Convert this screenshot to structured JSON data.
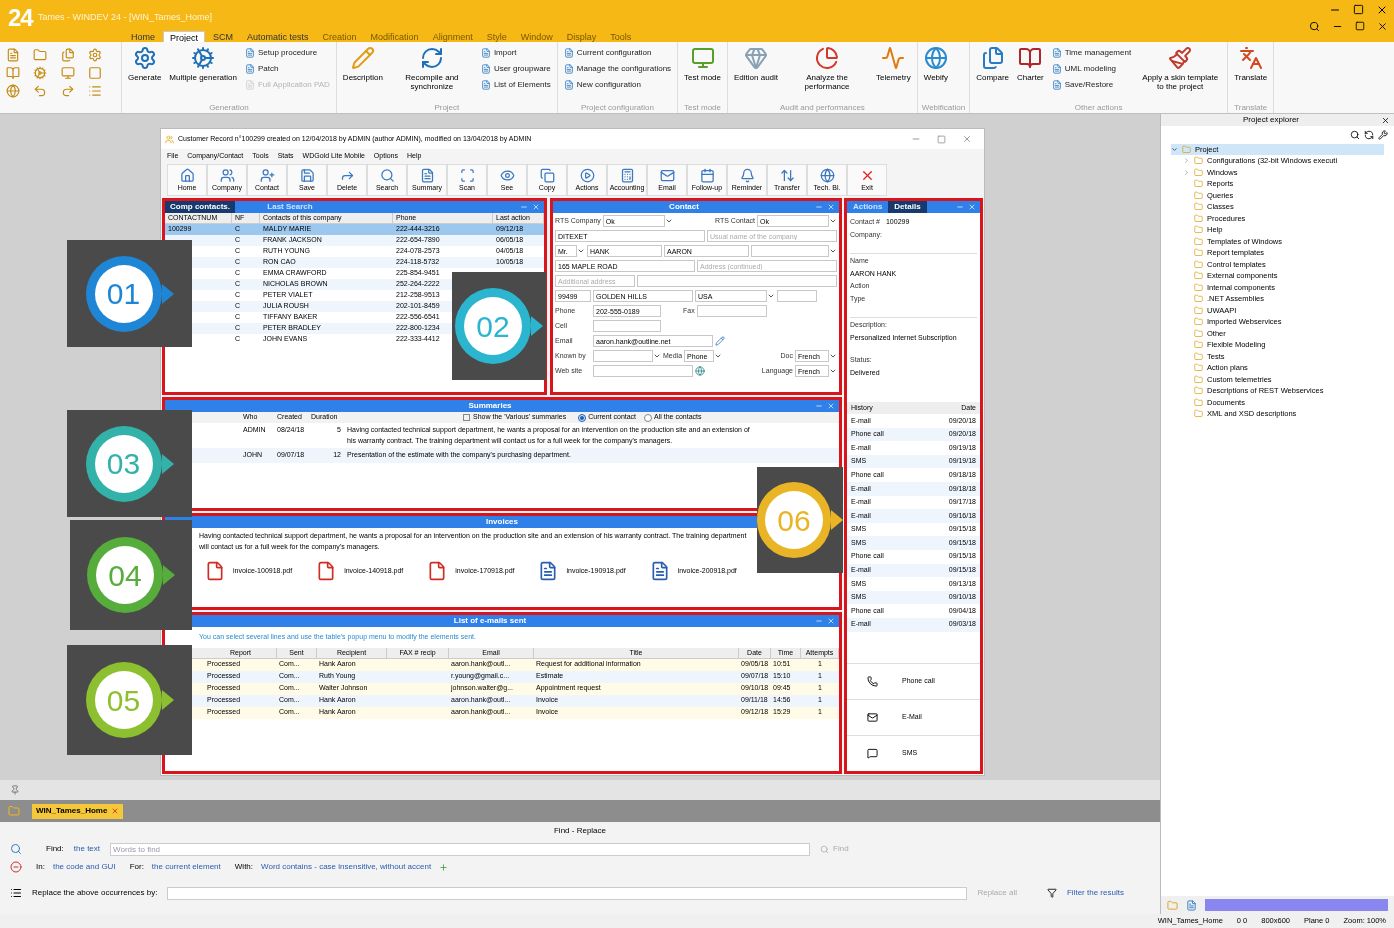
{
  "app": {
    "logo": "24",
    "title": "Tames - WINDEV 24 - [WIN_Tames_Home]"
  },
  "ribbon_tabs": [
    {
      "label": "Home",
      "selected": false
    },
    {
      "label": "Project",
      "selected": true
    },
    {
      "label": "SCM",
      "selected": false
    },
    {
      "label": "Automatic tests",
      "selected": false
    },
    {
      "label": "Creation",
      "selected": false
    },
    {
      "label": "Modification",
      "selected": false
    },
    {
      "label": "Alignment",
      "selected": false
    },
    {
      "label": "Style",
      "selected": false
    },
    {
      "label": "Window",
      "selected": false
    },
    {
      "label": "Display",
      "selected": false
    },
    {
      "label": "Tools",
      "selected": false
    }
  ],
  "ribbon_groups": [
    {
      "title": "Generation",
      "items": [
        {
          "kind": "large",
          "label": "Generate"
        },
        {
          "kind": "large",
          "label": "Multiple generation"
        },
        {
          "kind": "stack",
          "items": [
            {
              "label": "Setup procedure",
              "disabled": false
            },
            {
              "label": "Patch",
              "disabled": false
            },
            {
              "label": "Full Application PAD",
              "disabled": true
            }
          ]
        }
      ]
    },
    {
      "title": "Project",
      "items": [
        {
          "kind": "large",
          "label": "Description"
        },
        {
          "kind": "large",
          "label": "Recompile and synchronize"
        },
        {
          "kind": "stack",
          "items": [
            {
              "label": "Import",
              "disabled": false
            },
            {
              "label": "User groupware",
              "disabled": false
            },
            {
              "label": "List of Elements",
              "disabled": false
            }
          ]
        }
      ]
    },
    {
      "title": "Project configuration",
      "items": [
        {
          "kind": "stack",
          "items": [
            {
              "label": "Current configuration",
              "disabled": false
            },
            {
              "label": "Manage the configurations",
              "disabled": false
            },
            {
              "label": "New configuration",
              "disabled": false
            }
          ]
        }
      ]
    },
    {
      "title": "Test mode",
      "items": [
        {
          "kind": "large",
          "label": "Test mode"
        }
      ]
    },
    {
      "title": "Audit and performances",
      "items": [
        {
          "kind": "large",
          "label": "Edition audit"
        },
        {
          "kind": "large",
          "label": "Analyze the performance"
        },
        {
          "kind": "large",
          "label": "Telemetry"
        }
      ]
    },
    {
      "title": "Webification",
      "items": [
        {
          "kind": "large",
          "label": "Webify"
        }
      ]
    },
    {
      "title": "Other actions",
      "items": [
        {
          "kind": "large",
          "label": "Compare"
        },
        {
          "kind": "large",
          "label": "Charter"
        },
        {
          "kind": "stack",
          "items": [
            {
              "label": "Time management",
              "disabled": false
            },
            {
              "label": "UML modeling",
              "disabled": false
            },
            {
              "label": "Save/Restore",
              "disabled": false
            }
          ]
        },
        {
          "kind": "large",
          "label": "Apply a skin template to the project"
        }
      ]
    },
    {
      "title": "Translate",
      "items": [
        {
          "kind": "large",
          "label": "Translate"
        }
      ]
    }
  ],
  "window": {
    "title": "Customer Record n°100299 created on 12/04/2018 by ADMIN (author ADMIN), modified on 13/04/2018 by ADMIN",
    "menu": [
      "File",
      "Company/Contact",
      "Tools",
      "Stats",
      "WDGold Lite Mobile",
      "Options",
      "Help"
    ],
    "toolbar": [
      "Home",
      "Company",
      "Contact",
      "Save",
      "Delete",
      "Search",
      "Summary",
      "Scan",
      "See",
      "Copy",
      "Actions",
      "Accounting",
      "Email",
      "Follow-up",
      "Reminder",
      "Transfer",
      "Tech. Bl.",
      "Exit"
    ]
  },
  "comp_contacts": {
    "tabs": [
      {
        "label": "Comp contacts.",
        "selected": true
      },
      {
        "label": "Last Search",
        "selected": false
      }
    ],
    "columns": [
      "CONTACTNUM",
      "NF",
      "Contacts of this company",
      "Phone",
      "Last action"
    ],
    "rows": [
      {
        "number": "100299",
        "type": "C",
        "name": "MALDY MARIE",
        "phone": "222-444-3216",
        "last_action": "09/12/18",
        "selected": true
      },
      {
        "type": "C",
        "name": "FRANK JACKSON",
        "phone": "222-654-7890",
        "last_action": "06/05/18",
        "selected": false
      },
      {
        "type": "C",
        "name": "RUTH YOUNG",
        "phone": "224-078-2573",
        "last_action": "04/05/18",
        "selected": false
      },
      {
        "type": "C",
        "name": "RON CAO",
        "phone": "224-118-5732",
        "last_action": "10/05/18",
        "selected": false
      },
      {
        "type": "C",
        "name": "EMMA CRAWFORD",
        "phone": "225-854-9451",
        "selected": false
      },
      {
        "type": "C",
        "name": "NICHOLAS BROWN",
        "phone": "252-264-2222",
        "selected": false
      },
      {
        "type": "C",
        "name": "PETER VIALET",
        "phone": "212-258-9513",
        "selected": false
      },
      {
        "type": "C",
        "name": "JULIA ROUSH",
        "phone": "202-101-8459",
        "selected": false
      },
      {
        "type": "C",
        "name": "TIFFANY BAKER",
        "phone": "222-556-6541",
        "selected": false
      },
      {
        "type": "C",
        "name": "PETER BRADLEY",
        "phone": "222-800-1234",
        "selected": false
      },
      {
        "type": "C",
        "name": "JOHN EVANS",
        "phone": "222-333-4412",
        "selected": false
      }
    ]
  },
  "contact": {
    "title": "Contact",
    "rts_company_label": "RTS Company",
    "rts_company": "Ok",
    "rts_contact_label": "RTS Contact",
    "rts_contact": "Ok",
    "company": "DITEXET",
    "company_placeholder": "Usual name of the company",
    "salutation": "Mr.",
    "last_name": "HANK",
    "first_name": "AARON",
    "address": "165 MAPLE ROAD",
    "address2_placeholder": "Address (continued)",
    "additional_placeholder": "Additional address",
    "zip": "99499",
    "city": "GOLDEN HILLS",
    "country": "USA",
    "phone_label": "Phone",
    "phone": "202-555-0189",
    "fax_label": "Fax",
    "cell_label": "Cell",
    "email_label": "Email",
    "email": "aaron.hank@outline.net",
    "known_label": "Known by",
    "media_label": "Media",
    "media": "Phone",
    "doc_label": "Doc",
    "doc": "French",
    "language_label": "Language",
    "language": "French",
    "website_label": "Web site"
  },
  "summaries": {
    "title": "Summaries",
    "columns": [
      "Who",
      "Created",
      "Duration"
    ],
    "checkbox": {
      "label": "Show the 'Various' summaries",
      "checked": false
    },
    "radios": [
      {
        "label": "Current contact",
        "selected": true
      },
      {
        "label": "All the contacts",
        "selected": false
      }
    ],
    "rows": [
      {
        "who": "ADMIN",
        "created": "08/24/18",
        "duration": "5",
        "text": "Having contacted technical support department, he wants a proposal for an intervention on the production site and an extension of his warranty contract. The training department will contact us for a full week for the company's managers."
      },
      {
        "who": "JOHN",
        "created": "09/07/18",
        "duration": "12",
        "text": "Presentation of the estimate with the company's purchasing department."
      }
    ]
  },
  "invoices": {
    "title": "Invoices",
    "text": "Having contacted technical support department, he wants a proposal for an intervention on the production site and an extension of his warranty contract. The training department will contact us for a full week for the company's managers.",
    "files": [
      {
        "name": "invoice-100918.pdf",
        "kind": "pdf"
      },
      {
        "name": "invoice-140918.pdf",
        "kind": "pdf"
      },
      {
        "name": "invoice-170918.pdf",
        "kind": "pdf"
      },
      {
        "name": "invoice-190918.pdf",
        "kind": "doc"
      },
      {
        "name": "invoice-200918.pdf",
        "kind": "doc"
      }
    ]
  },
  "emails": {
    "title": "List of e-mails sent",
    "hint": "You can select several lines and use the table's popup menu to modify the elements sent.",
    "columns": [
      "Report",
      "Sent",
      "Recipient",
      "FAX # recip",
      "Email",
      "Title",
      "Date",
      "Time",
      "Attempts"
    ],
    "rows": [
      [
        "Processed",
        "Com...",
        "Hank Aaron",
        "",
        "aaron.hank@outl...",
        "Request for additional information",
        "09/05/18",
        "10:51",
        "1"
      ],
      [
        "Processed",
        "Com...",
        "Ruth Young",
        "",
        "r.young@gmail.c...",
        "Estimate",
        "09/07/18",
        "15:10",
        "1"
      ],
      [
        "Processed",
        "Com...",
        "Walter Johnson",
        "",
        "johnson.walter@g...",
        "Appointment request",
        "09/10/18",
        "09:45",
        "1"
      ],
      [
        "Processed",
        "Com...",
        "Hank Aaron",
        "",
        "aaron.hank@outl...",
        "Invoice",
        "09/11/18",
        "14:56",
        "1"
      ],
      [
        "Processed",
        "Com...",
        "Hank Aaron",
        "",
        "aaron.hank@outl...",
        "Invoice",
        "09/12/18",
        "15:29",
        "1"
      ]
    ]
  },
  "details": {
    "tabs": [
      {
        "label": "Actions",
        "selected": false
      },
      {
        "label": "Details",
        "selected": true
      }
    ],
    "contact_label": "Contact #",
    "contact_number": "100299",
    "company_label": "Company:",
    "name_label": "Name",
    "name": "AARON HANK",
    "action_label": "Action",
    "type_label": "Type",
    "description_label": "Description:",
    "description": "Personalized Internet Subscription",
    "status_label": "Status:",
    "status": "Delivered",
    "history_columns": [
      "History",
      "Date"
    ],
    "history": [
      [
        "E-mail",
        "09/20/18"
      ],
      [
        "Phone call",
        "09/20/18"
      ],
      [
        "E-mail",
        "09/19/18"
      ],
      [
        "SMS",
        "09/19/18"
      ],
      [
        "Phone call",
        "09/18/18"
      ],
      [
        "E-mail",
        "09/18/18"
      ],
      [
        "E-mail",
        "09/17/18"
      ],
      [
        "E-mail",
        "09/16/18"
      ],
      [
        "SMS",
        "09/15/18"
      ],
      [
        "SMS",
        "09/15/18"
      ],
      [
        "Phone call",
        "09/15/18"
      ],
      [
        "E-mail",
        "09/15/18"
      ],
      [
        "SMS",
        "09/13/18"
      ],
      [
        "SMS",
        "09/10/18"
      ],
      [
        "Phone call",
        "09/04/18"
      ],
      [
        "E-mail",
        "09/03/18"
      ]
    ],
    "actions": [
      {
        "label": "Phone call",
        "kind": "phone"
      },
      {
        "label": "E-Mail",
        "kind": "mail"
      },
      {
        "label": "SMS",
        "kind": "sms"
      }
    ]
  },
  "callouts": [
    {
      "label": "01",
      "color": "#1f86d6"
    },
    {
      "label": "02",
      "color": "#2bb5cf"
    },
    {
      "label": "03",
      "color": "#33b2aa"
    },
    {
      "label": "04",
      "color": "#56ad3c"
    },
    {
      "label": "05",
      "color": "#8dc030"
    },
    {
      "label": "06",
      "color": "#e9b526"
    }
  ],
  "explorer": {
    "title": "Project explorer",
    "root": {
      "label": "Project",
      "expanded": true,
      "selected": true,
      "children": [
        {
          "label": "Configurations (32-bit Windows executi",
          "expandable": true,
          "selected": false
        },
        {
          "label": "Windows",
          "expandable": true,
          "selected": false
        },
        {
          "label": "Reports",
          "expandable": false,
          "selected": false
        },
        {
          "label": "Queries",
          "expandable": false,
          "selected": false
        },
        {
          "label": "Classes",
          "expandable": false,
          "selected": false
        },
        {
          "label": "Procedures",
          "expandable": false,
          "selected": false
        },
        {
          "label": "Help",
          "expandable": false,
          "selected": false
        },
        {
          "label": "Templates of Windows",
          "expandable": false,
          "selected": false
        },
        {
          "label": "Report templates",
          "expandable": false,
          "selected": false
        },
        {
          "label": "Control templates",
          "expandable": false,
          "selected": false
        },
        {
          "label": "External components",
          "expandable": false,
          "selected": false
        },
        {
          "label": "Internal components",
          "expandable": false,
          "selected": false
        },
        {
          "label": ".NET Assemblies",
          "expandable": false,
          "selected": false
        },
        {
          "label": "UWAAPI",
          "expandable": false,
          "selected": false
        },
        {
          "label": "Imported Webservices",
          "expandable": false,
          "selected": false
        },
        {
          "label": "Other",
          "expandable": false,
          "selected": false
        },
        {
          "label": "Flexible Modeling",
          "expandable": false,
          "selected": false
        },
        {
          "label": "Tests",
          "expandable": false,
          "selected": false
        },
        {
          "label": "Action plans",
          "expandable": false,
          "selected": false
        },
        {
          "label": "Custom telemetries",
          "expandable": false,
          "selected": false
        },
        {
          "label": "Descriptions of REST Webservices",
          "expandable": false,
          "selected": false
        },
        {
          "label": "Documents",
          "expandable": false,
          "selected": false
        },
        {
          "label": "XML and XSD descriptions",
          "expandable": false,
          "selected": false
        }
      ]
    }
  },
  "editor_tab": {
    "label": "WIN_Tames_Home"
  },
  "find_replace": {
    "title": "Find - Replace",
    "find_label": "Find:",
    "scope": "the text",
    "placeholder": "Words to find",
    "find_button": "Find",
    "options": [
      {
        "label": "In:",
        "value": "the code and GUI"
      },
      {
        "label": "For:",
        "value": "the current element"
      },
      {
        "label": "With:",
        "value": "Word contains - case insensitive, without accent"
      }
    ],
    "replace_label": "Replace the above occurrences by:",
    "replace_button": "Replace all",
    "filter": "Filter the results"
  },
  "status_bar": [
    "WIN_Tames_Home",
    "0 0",
    "800x600",
    "Plane 0",
    "Zoom: 100%"
  ]
}
